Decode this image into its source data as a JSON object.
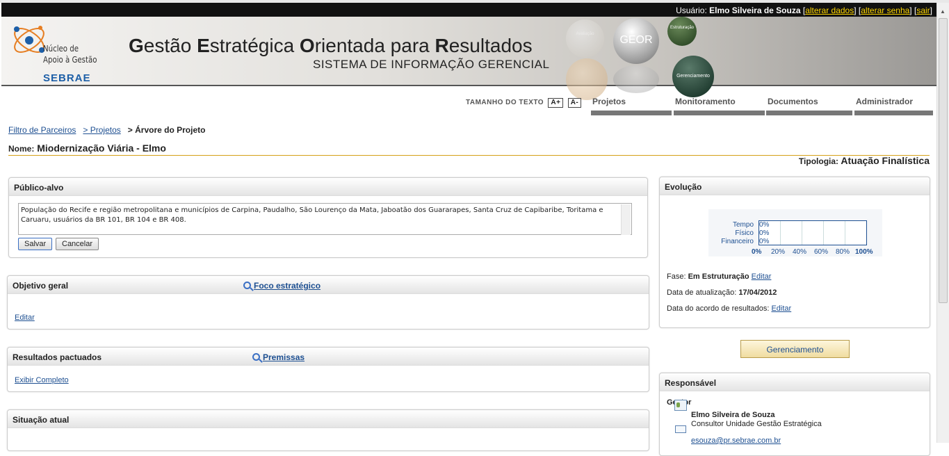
{
  "userbar": {
    "user_label": "Usuário:",
    "user_name": "Elmo Silveira de Souza",
    "links": [
      "alterar dados",
      "alterar senha",
      "sair"
    ]
  },
  "header": {
    "logo_line1": "Núcleo de",
    "logo_line2": "Apoio à Gestão",
    "logo_brand": "SEBRAE",
    "title_letters": [
      "G",
      "E",
      "O",
      "R"
    ],
    "title_rest": [
      "estão ",
      "stratégica ",
      "rientada para ",
      "esultados"
    ],
    "subtitle": "SISTEMA DE INFORMAÇÃO GERENCIAL",
    "sphere_geor": "GEOR",
    "sphere_estruturacao": "Estruturação",
    "sphere_gerenciamento": "Gerenciamento",
    "sphere_avaliacao": "Avaliação"
  },
  "toolbar": {
    "text_size_label": "TAMANHO DO TEXTO",
    "increase": "A+",
    "decrease": "A-"
  },
  "nav": [
    "Projetos",
    "Monitoramento",
    "Documentos",
    "Administrador"
  ],
  "breadcrumb": {
    "item1": "Filtro de Parceiros",
    "item2": "> Projetos",
    "current": "> Árvore do Projeto"
  },
  "project": {
    "name_label": "Nome:",
    "name": "Miodernização Viária - Elmo",
    "tipologia_label": "Tipologia:",
    "tipologia": "Atuação Finalística"
  },
  "publico_alvo": {
    "title": "Público-alvo",
    "text": "População do Recife e região metropolitana e municípios de Carpina, Paudalho, São Lourenço da Mata, Jaboatão dos Guararapes, Santa Cruz de Capibaribe, Toritama e Caruaru, usuários da BR 101, BR 104 e BR 408.",
    "save": "Salvar",
    "cancel": "Cancelar"
  },
  "objetivo": {
    "title": "Objetivo geral",
    "foco": "Foco estratégico",
    "edit": "Editar"
  },
  "resultados": {
    "title": "Resultados pactuados",
    "premissas": "Premissas",
    "exibir": "Exibir Completo"
  },
  "situacao": {
    "title": "Situação atual"
  },
  "evolucao": {
    "title": "Evolução",
    "rows": [
      {
        "label": "Tempo",
        "value": "0%"
      },
      {
        "label": "Físico",
        "value": "0%"
      },
      {
        "label": "Financeiro",
        "value": "0%"
      }
    ],
    "ticks": [
      "0%",
      "20%",
      "40%",
      "60%",
      "80%",
      "100%"
    ],
    "fase_label": "Fase:",
    "fase": "Em Estruturação",
    "fase_edit": "Editar",
    "atualizacao_label": "Data de atualização:",
    "atualizacao": "17/04/2012",
    "acordo_label": "Data do acordo de resultados:",
    "acordo_edit": "Editar"
  },
  "gerenciamento_button": "Gerenciamento",
  "responsavel": {
    "title": "Responsável",
    "role": "Gestor",
    "name": "Elmo Silveira de Souza",
    "position": "Consultor Unidade Gestão Estratégica",
    "email": "esouza@pr.sebrae.com.br"
  }
}
